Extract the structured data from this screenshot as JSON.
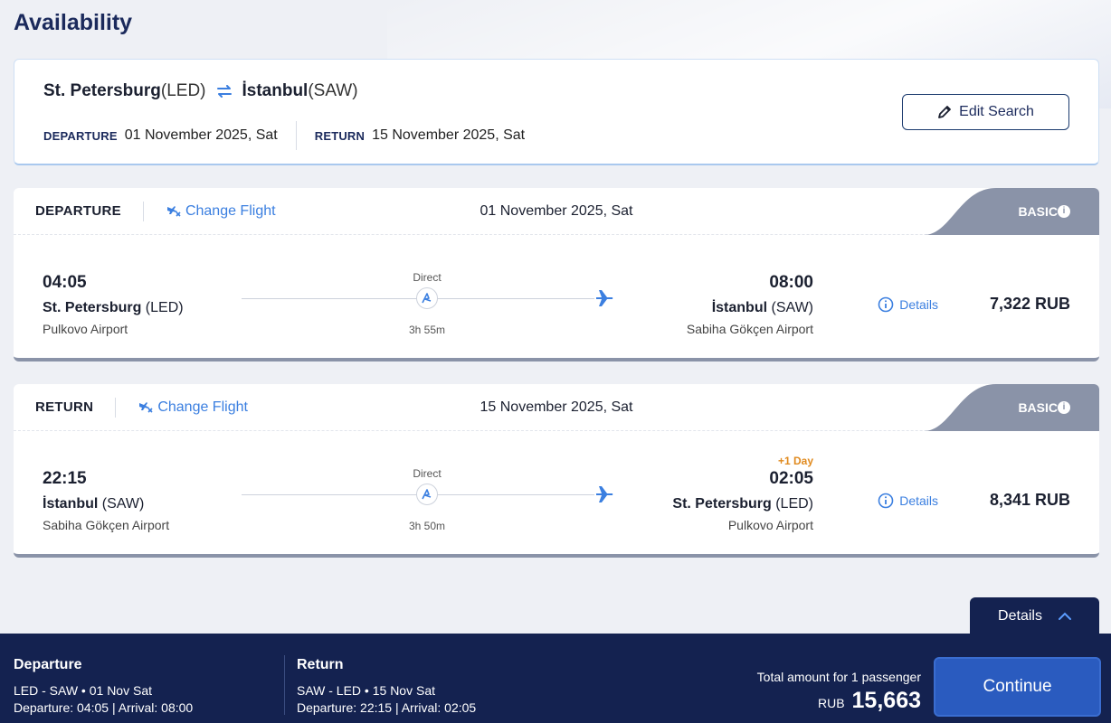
{
  "page": {
    "title": "Availability"
  },
  "search": {
    "origin_city": "St. Petersburg",
    "origin_code": "(LED)",
    "dest_city": "İstanbul",
    "dest_code": "(SAW)",
    "departure_label": "DEPARTURE",
    "departure_date": "01 November 2025, Sat",
    "return_label": "RETURN",
    "return_date": "15 November 2025, Sat",
    "edit_label": "Edit Search"
  },
  "flights": [
    {
      "type": "DEPARTURE",
      "change_label": "Change Flight",
      "date": "01 November 2025, Sat",
      "fare": "BASIC",
      "dep_time": "04:05",
      "dep_city": "St. Petersburg",
      "dep_code": " (LED)",
      "dep_airport": "Pulkovo Airport",
      "stops": "Direct",
      "duration": "3h 55m",
      "arr_time": "08:00",
      "arr_city": "İstanbul",
      "arr_code": " (SAW)",
      "arr_airport": "Sabiha Gökçen Airport",
      "plus_day": "",
      "details_label": "Details",
      "price": "7,322 RUB"
    },
    {
      "type": "RETURN",
      "change_label": "Change Flight",
      "date": "15 November 2025, Sat",
      "fare": "BASIC",
      "dep_time": "22:15",
      "dep_city": "İstanbul",
      "dep_code": " (SAW)",
      "dep_airport": "Sabiha Gökçen Airport",
      "stops": "Direct",
      "duration": "3h 50m",
      "arr_time": "02:05",
      "arr_city": "St. Petersburg",
      "arr_code": " (LED)",
      "arr_airport": "Pulkovo Airport",
      "plus_day": "+1 Day",
      "details_label": "Details",
      "price": "8,341 RUB"
    }
  ],
  "summary": {
    "details_tab": "Details",
    "departure_title": "Departure",
    "departure_route": "LED - SAW • 01 Nov Sat",
    "departure_times": "Departure: 04:05 | Arrival: 08:00",
    "return_title": "Return",
    "return_route": "SAW - LED • 15 Nov Sat",
    "return_times": "Departure: 22:15 | Arrival: 02:05",
    "total_label": "Total amount for 1 passenger",
    "currency": "RUB",
    "total": "15,663",
    "continue_label": "Continue"
  },
  "colors": {
    "navy": "#142250",
    "accent_blue": "#3b7fe0",
    "fare_tab": "#8a93a8",
    "plus_day": "#e08a1e"
  }
}
